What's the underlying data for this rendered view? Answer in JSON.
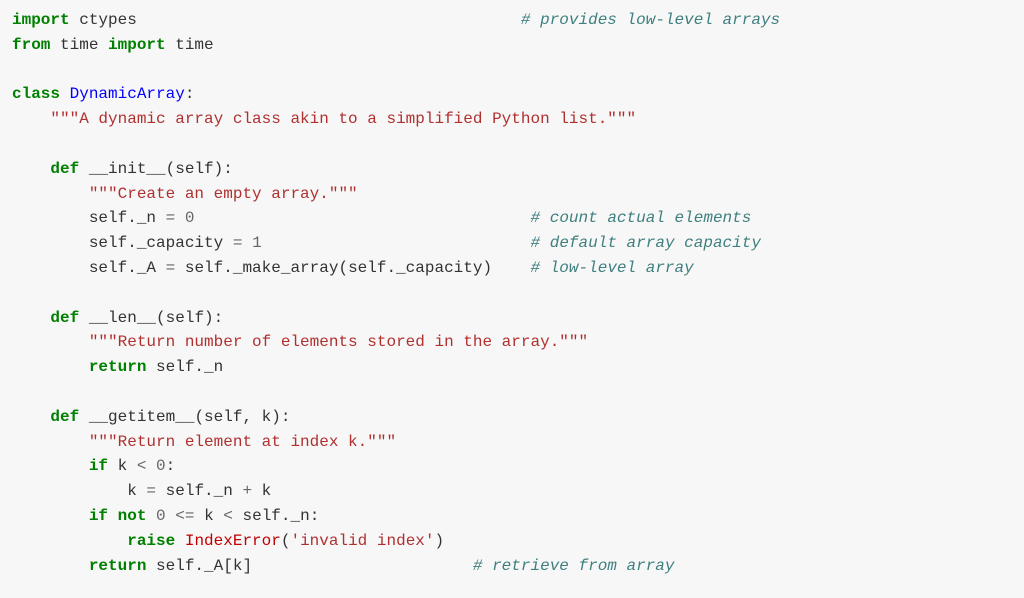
{
  "code": {
    "l1_kw1": "import",
    "l1_mod": " ctypes                                        ",
    "l1_cmt": "# provides low-level arrays",
    "l2_kw1": "from",
    "l2_mod": " time ",
    "l2_kw2": "import",
    "l2_id": " time",
    "l4_kw": "class",
    "l4_cls": " DynamicArray",
    "l4_colon": ":",
    "l5_doc": "\"\"\"A dynamic array class akin to a simplified Python list.\"\"\"",
    "l7_def": "def",
    "l7_fn": " __init__",
    "l7_sig": "(self):",
    "l8_doc": "\"\"\"Create an empty array.\"\"\"",
    "l9a": "self._n ",
    "l9op": "=",
    "l9sp": " ",
    "l9num": "0",
    "l9pad": "                                   ",
    "l9cmt": "# count actual elements",
    "l10a": "self._capacity ",
    "l10op": "=",
    "l10sp": " ",
    "l10num": "1",
    "l10pad": "                            ",
    "l10cmt": "# default array capacity",
    "l11a": "self._A ",
    "l11op": "=",
    "l11b": " self._make_array(self._capacity)    ",
    "l11cmt": "# low-level array",
    "l13_def": "def",
    "l13_fn": " __len__",
    "l13_sig": "(self):",
    "l14_doc": "\"\"\"Return number of elements stored in the array.\"\"\"",
    "l15_kw": "return",
    "l15_expr": " self._n",
    "l17_def": "def",
    "l17_fn": " __getitem__",
    "l17_sig": "(self, k):",
    "l18_doc": "\"\"\"Return element at index k.\"\"\"",
    "l19_kw": "if",
    "l19_a": " k ",
    "l19_op": "<",
    "l19_sp": " ",
    "l19_num": "0",
    "l19_colon": ":",
    "l20_a": "k ",
    "l20_op1": "=",
    "l20_b": " self._n ",
    "l20_op2": "+",
    "l20_c": " k",
    "l21_kw1": "if",
    "l21_sp1": " ",
    "l21_kw2": "not",
    "l21_sp2": " ",
    "l21_num1": "0",
    "l21_sp3": " ",
    "l21_op1": "<=",
    "l21_mid": " k ",
    "l21_op2": "<",
    "l21_c": " self._n:",
    "l22_kw": "raise",
    "l22_sp": " ",
    "l22_err": "IndexError",
    "l22_p1": "(",
    "l22_str": "'invalid index'",
    "l22_p2": ")",
    "l23_kw": "return",
    "l23_expr": " self._A[k]                       ",
    "l23_cmt": "# retrieve from array"
  }
}
